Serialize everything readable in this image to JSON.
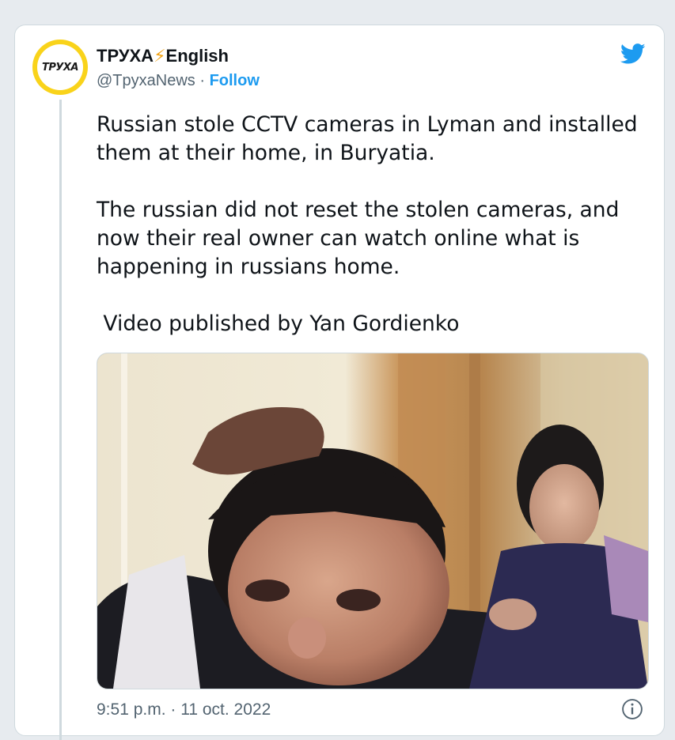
{
  "author": {
    "avatar_text": "ТРУХА",
    "display_name": "ТРУХА",
    "bolt": "⚡",
    "display_name_suffix": "English",
    "handle": "@TpyxaNews",
    "separator": " · ",
    "follow_label": "Follow"
  },
  "tweet": {
    "paragraph1_line1": "Russian stole CCTV cameras in Lyman and installed",
    "paragraph1_line2": "them at their home, in Buryatia.",
    "paragraph2_line1": "The russian did not reset the stolen cameras, and",
    "paragraph2_line2": "now their real owner can watch online what is",
    "paragraph2_line3": "happening in russians home.",
    "paragraph3": " Video published by Yan Gordienko"
  },
  "footer": {
    "timestamp": "9:51 p.m. · 11 oct. 2022"
  },
  "icons": {
    "brand": "twitter-bird-icon",
    "info": "info-icon"
  },
  "colors": {
    "accent": "#1d9bf0",
    "avatar_ring": "#f9d31a",
    "secondary_text": "#536471"
  }
}
